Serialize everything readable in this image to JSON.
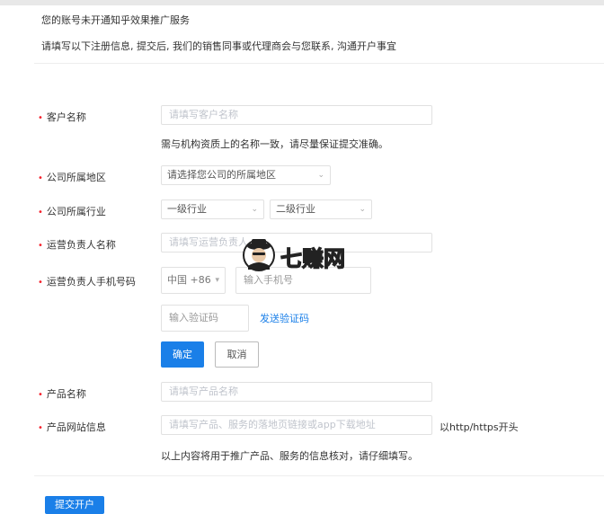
{
  "notice": {
    "title": "您的账号未开通知乎效果推广服务",
    "subtitle": "请填写以下注册信息, 提交后, 我们的销售同事或代理商会与您联系, 沟通开户事宜"
  },
  "form": {
    "customer_name": {
      "label": "客户名称",
      "placeholder": "请填写客户名称",
      "hint": "需与机构资质上的名称一致，请尽量保证提交准确。"
    },
    "company_region": {
      "label": "公司所属地区",
      "value": "请选择您公司的所属地区"
    },
    "company_industry": {
      "label": "公司所属行业",
      "primary": "一级行业",
      "secondary": "二级行业"
    },
    "operator_name": {
      "label": "运营负责人名称",
      "placeholder": "请填写运营负责人"
    },
    "operator_phone": {
      "label": "运营负责人手机号码",
      "country_code": "中国 +86",
      "phone_placeholder": "输入手机号",
      "code_placeholder": "输入验证码",
      "send_code": "发送验证码",
      "confirm": "确定",
      "cancel": "取消"
    },
    "product_name": {
      "label": "产品名称",
      "placeholder": "请填写产品名称"
    },
    "product_site": {
      "label": "产品网站信息",
      "placeholder": "请填写产品、服务的落地页链接或app下载地址",
      "suffix": "以http/https开头",
      "hint": "以上内容将用于推广产品、服务的信息核对，请仔细填写。"
    },
    "submit": "提交开户"
  },
  "watermark": {
    "text": "七赚网"
  },
  "colors": {
    "primary": "#1a7fe8",
    "required": "#f5222d"
  }
}
